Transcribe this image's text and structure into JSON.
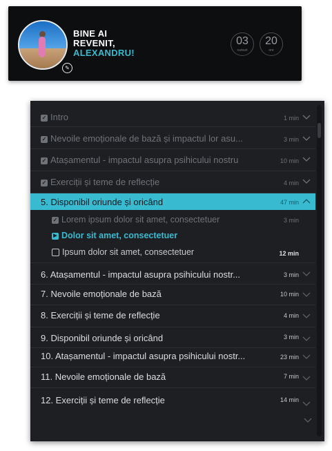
{
  "welcome": {
    "greeting_line1": "BINE AI",
    "greeting_line2": "REVENIT,",
    "user_name": "ALEXANDRU!",
    "stats": [
      {
        "value": "03",
        "label": "cursuri"
      },
      {
        "value": "20",
        "label": "ore"
      }
    ],
    "avatar_icon": "profile-photo",
    "edit_icon": "edit-icon"
  },
  "lessons": [
    {
      "title": "Intro",
      "duration": "1 min",
      "state": "completed"
    },
    {
      "title": "Nevoile emoționale de bază și impactul lor asu...",
      "duration": "3 min",
      "state": "completed"
    },
    {
      "title": "Atașamentul - impactul asupra psihicului nostru",
      "duration": "10 min",
      "state": "completed"
    },
    {
      "title": "Exerciții și teme de reflecție",
      "duration": "4 min",
      "state": "completed"
    },
    {
      "title": "5. Disponibil oriunde și oricând",
      "duration": "47 min",
      "state": "expanded",
      "subitems": [
        {
          "title": "Lorem ipsum dolor sit amet, consectetuer",
          "duration": "3 min",
          "state": "completed"
        },
        {
          "title": "Dolor sit amet, consectetuer",
          "duration": "",
          "state": "current"
        },
        {
          "title": "Ipsum dolor sit amet, consectetuer",
          "duration": "12 min",
          "state": "pending"
        }
      ]
    },
    {
      "title": "6. Atașamentul - impactul asupra psihicului nostr...",
      "duration": "3 min",
      "state": "todo"
    },
    {
      "title": "7. Nevoile emoționale de bază",
      "duration": "10 min",
      "state": "todo"
    },
    {
      "title": "8. Exerciții și teme de reflecție",
      "duration": "4 min",
      "state": "todo"
    },
    {
      "title": "9. Disponibil oriunde și oricând",
      "duration": "3 min",
      "state": "todo"
    },
    {
      "title": "10. Atașamentul - impactul asupra psihicului nostr...",
      "duration": "23 min",
      "state": "todo"
    },
    {
      "title": "11. Nevoile emoționale de bază",
      "duration": "7 min",
      "state": "todo"
    },
    {
      "title": "12. Exerciții și teme de reflecție",
      "duration": "14 min",
      "state": "todo"
    }
  ],
  "colors": {
    "accent": "#38bbd0",
    "panel": "#1d1f22",
    "header": "#0d0e10"
  }
}
